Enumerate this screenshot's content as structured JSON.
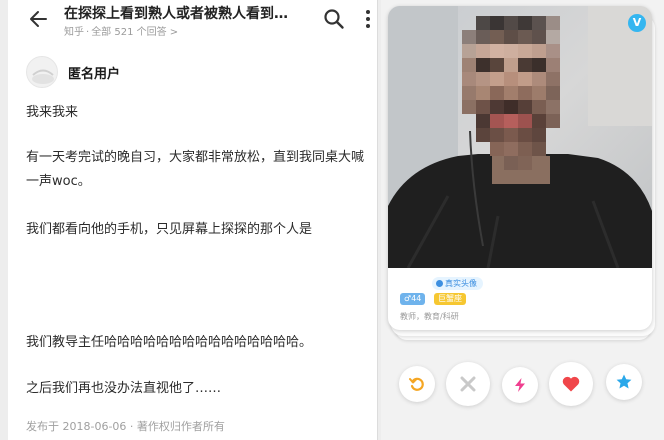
{
  "question": {
    "title": "在探探上看到熟人或者被熟人看到…",
    "source": "知乎",
    "answers_link": "全部 521 个回答 >"
  },
  "answer": {
    "author": "匿名用户",
    "paragraphs": [
      "我来我来",
      "有一天考完试的晚自习，大家都非常放松，直到我同桌大喊一声woc。",
      "我们都看向他的手机，只见屏幕上探探的那个人是",
      "我们教导主任哈哈哈哈哈哈哈哈哈哈哈哈哈哈哈。",
      "之后我们再也没办法直视他了……"
    ],
    "footer": "发布于 2018-06-06 · 著作权归作者所有"
  },
  "profile": {
    "verified_label": "V",
    "real_photo_badge": "真实头像",
    "age_tag": "♂44",
    "zodiac_tag": "巨蟹座",
    "occupation": "教师，教育/科研"
  },
  "colors": {
    "accent_blue": "#35b6f0",
    "like_red": "#f0464a",
    "superlike_blue": "#2aa8ea",
    "rewind_yellow": "#f5a623",
    "boost_pink": "#ef3f8f",
    "nope_gray": "#c9c9c9"
  },
  "icons": {
    "back": "arrow-left-icon",
    "search": "search-icon",
    "more": "more-vertical-icon",
    "rewind": "rewind-icon",
    "nope": "close-icon",
    "boost": "lightning-icon",
    "like": "heart-icon",
    "superlike": "star-icon"
  }
}
